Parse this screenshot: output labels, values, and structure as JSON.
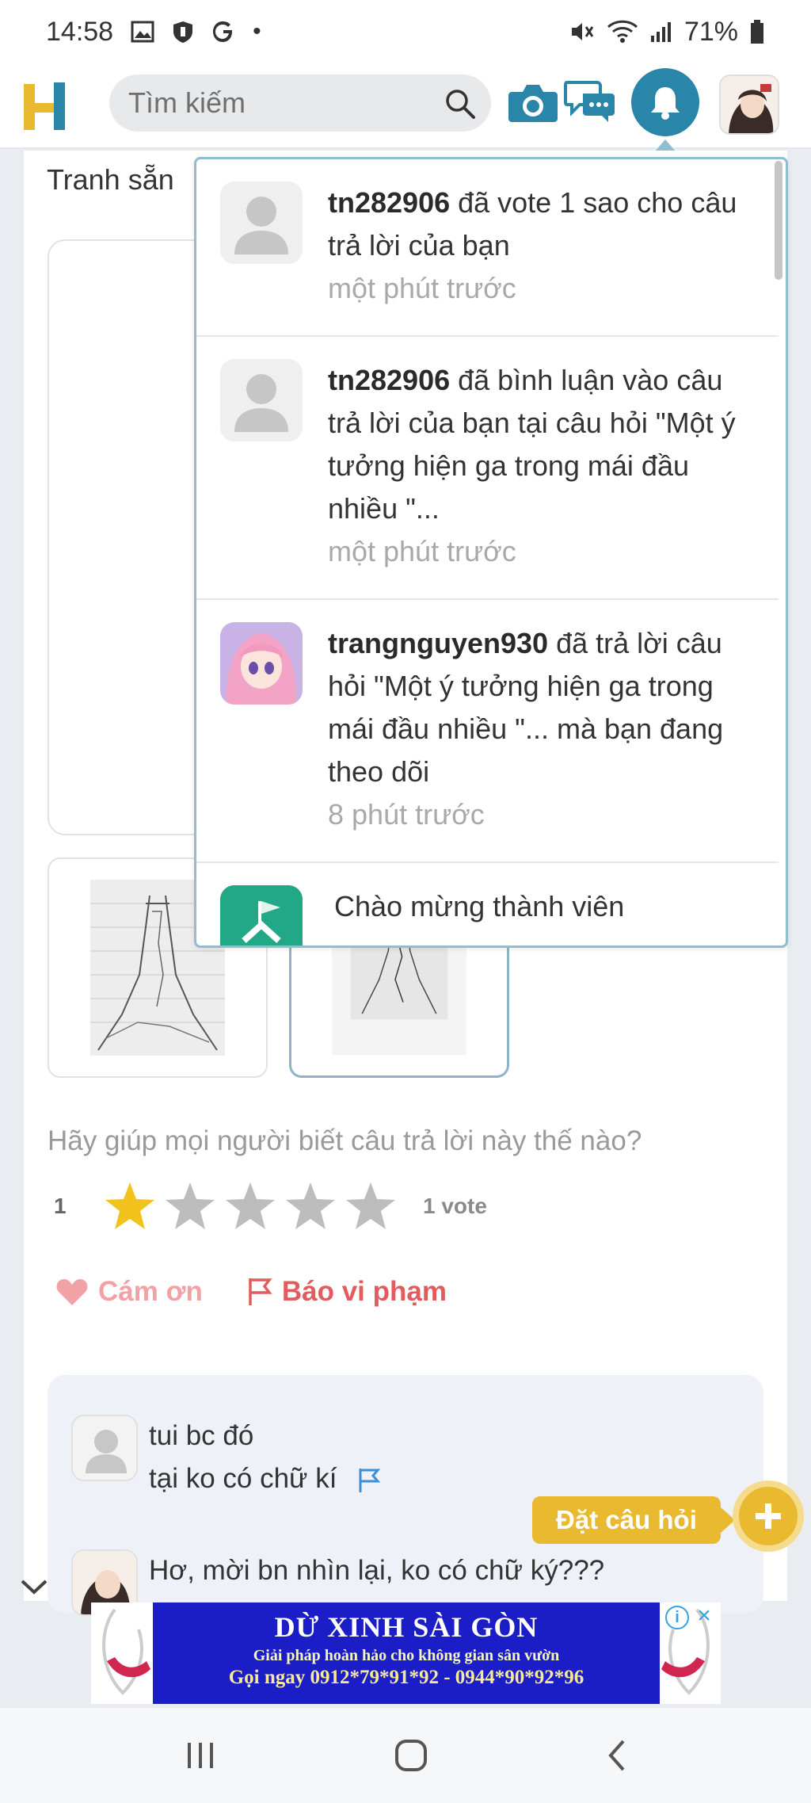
{
  "status_bar": {
    "time": "14:58",
    "battery": "71%"
  },
  "header": {
    "search_placeholder": "Tìm kiếm"
  },
  "main": {
    "ready_text": "Tranh sẵn",
    "question_prompt": "Hãy giúp mọi người biết câu trả lời này thế nào?",
    "rating": {
      "value": "1",
      "stars_filled": 1,
      "stars_total": 5,
      "votes": "1 vote"
    },
    "thanks_label": "Cám ơn",
    "report_label": "Báo vi phạm",
    "comments": [
      {
        "line1": "tui bc đó",
        "line2": "tại ko có chữ kí"
      },
      {
        "line1": "Hơ, mời bn nhìn lại, ko có chữ ký???"
      }
    ]
  },
  "notifications": [
    {
      "user": "tn282906",
      "message": " đã vote 1 sao cho câu trả lời của bạn",
      "time": "một phút trước"
    },
    {
      "user": "tn282906",
      "message": " đã bình luận vào câu trả lời của bạn tại câu hỏi \"Một ý tưởng hiện ga trong mái đầu nhiều  \"...",
      "time": "một phút trước"
    },
    {
      "user": "trangnguyen930",
      "message": " đã trả lời câu hỏi \"Một ý tưởng hiện ga trong mái đầu nhiều  \"... mà bạn đang theo dõi",
      "time": "8 phút trước"
    },
    {
      "message": "Chào mừng thành viên"
    }
  ],
  "ask_button_label": "Đặt câu hỏi",
  "ad": {
    "title": "DỪ XINH SÀI GÒN",
    "subtitle": "Giải pháp hoàn hảo cho không gian sân vườn",
    "phone": "Gọi ngay 0912*79*91*92 - 0944*90*92*96"
  },
  "colors": {
    "brand_blue": "#2a86a8",
    "accent_yellow": "#e9b92f",
    "report_red": "#e15c5e"
  }
}
